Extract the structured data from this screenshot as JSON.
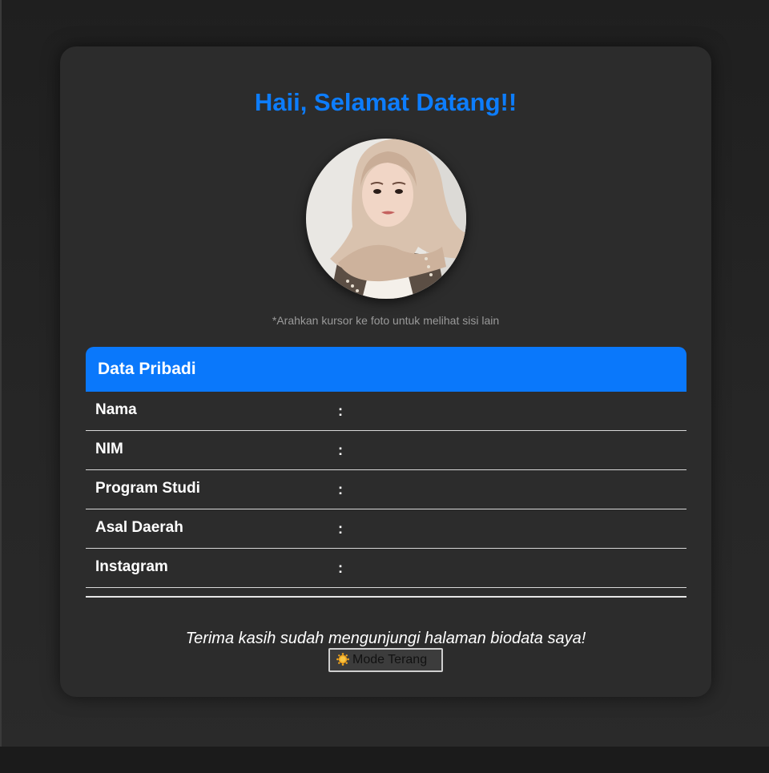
{
  "header": {
    "title": "Haii, Selamat Datang!!"
  },
  "profile": {
    "photo_alt": "Foto profil",
    "hint": "*Arahkan kursor ke foto untuk melihat sisi lain"
  },
  "section": {
    "title": "Data Pribadi",
    "rows": [
      {
        "label": "Nama",
        "separator": ":",
        "value": ""
      },
      {
        "label": "NIM",
        "separator": ":",
        "value": ""
      },
      {
        "label": "Program Studi",
        "separator": ":",
        "value": ""
      },
      {
        "label": "Asal Daerah",
        "separator": ":",
        "value": ""
      },
      {
        "label": "Instagram",
        "separator": ":",
        "value": ""
      }
    ]
  },
  "footer": {
    "thanks": "Terima kasih sudah mengunjungi halaman biodata saya!",
    "mode_button_label": "Mode Terang",
    "mode_button_icon": "sun-icon"
  },
  "colors": {
    "accent": "#0a78fb",
    "title": "#0d7dfc",
    "card_bg": "#2c2c2c",
    "page_bg": "#222222"
  }
}
